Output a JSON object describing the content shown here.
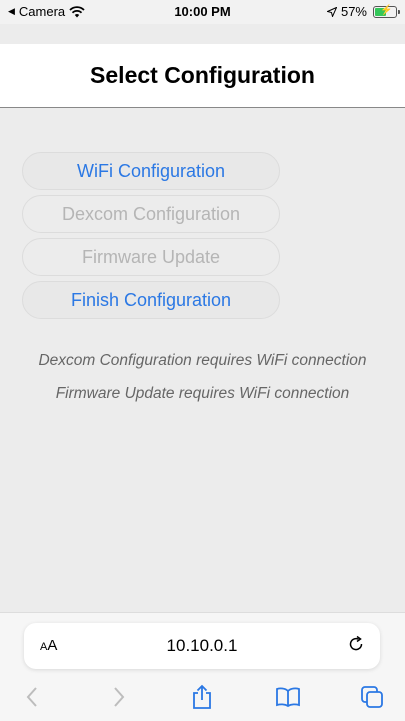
{
  "status_bar": {
    "back_app": "Camera",
    "time": "10:00 PM",
    "battery_percent": "57%",
    "battery_level": 0.57,
    "battery_color": "#34c759"
  },
  "header": {
    "title": "Select Configuration"
  },
  "menu": {
    "items": [
      {
        "label": "WiFi Configuration",
        "state": "enabled"
      },
      {
        "label": "Dexcom Configuration",
        "state": "disabled"
      },
      {
        "label": "Firmware Update",
        "state": "disabled"
      },
      {
        "label": "Finish Configuration",
        "state": "enabled"
      }
    ],
    "active_color": "#2b78e4",
    "disabled_color": "#b5b5b5"
  },
  "notes": [
    "Dexcom Configuration requires WiFi connection",
    "Firmware Update requires WiFi connection"
  ],
  "browser": {
    "text_size_label_small": "A",
    "text_size_label_large": "A",
    "url": "10.10.0.1",
    "icons": [
      "reload-icon",
      "back-icon",
      "forward-icon",
      "share-icon",
      "bookmarks-icon",
      "tabs-icon"
    ]
  }
}
